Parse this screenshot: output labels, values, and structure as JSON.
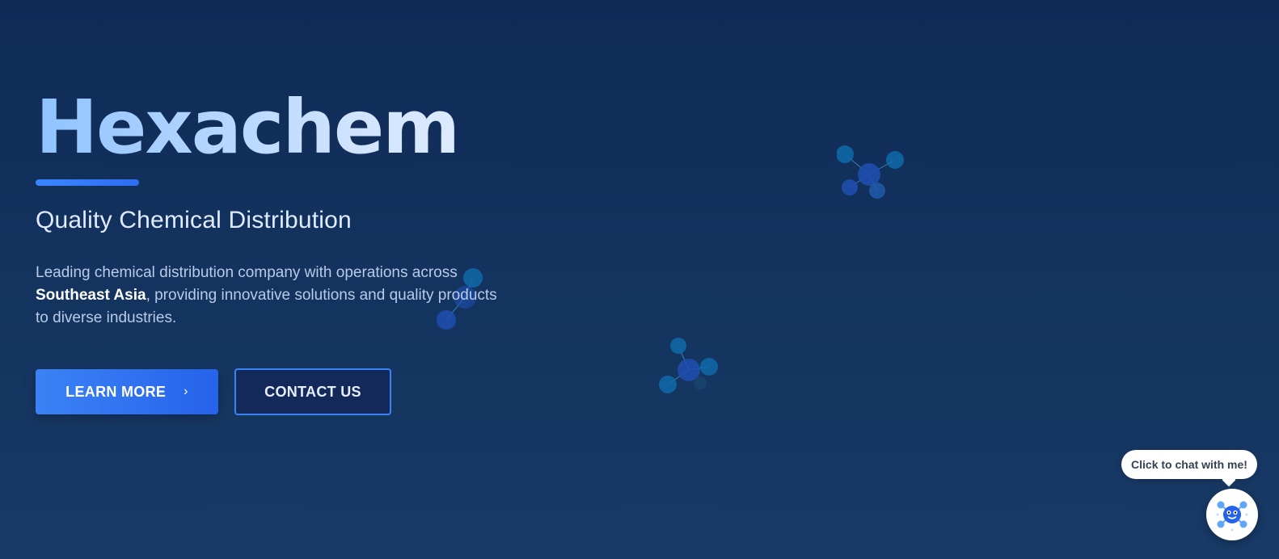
{
  "hero": {
    "brand": "Hexachem",
    "subtitle": "Quality Chemical Distribution",
    "description_part1": "Leading chemical distribution company with operations across ",
    "description_bold": "Southeast Asia",
    "description_part2": ", providing innovative solutions and quality products to diverse industries."
  },
  "buttons": {
    "learn_more": "LEARN MORE",
    "learn_more_icon": "chevron-right-icon",
    "contact_us": "CONTACT US"
  },
  "chat": {
    "bubble_text": "Click to chat with me!",
    "icon": "chatbot-molecule-icon"
  },
  "colors": {
    "accent": "#3b82f6",
    "background_top": "#0f2a57",
    "background_bottom": "#183a66"
  }
}
